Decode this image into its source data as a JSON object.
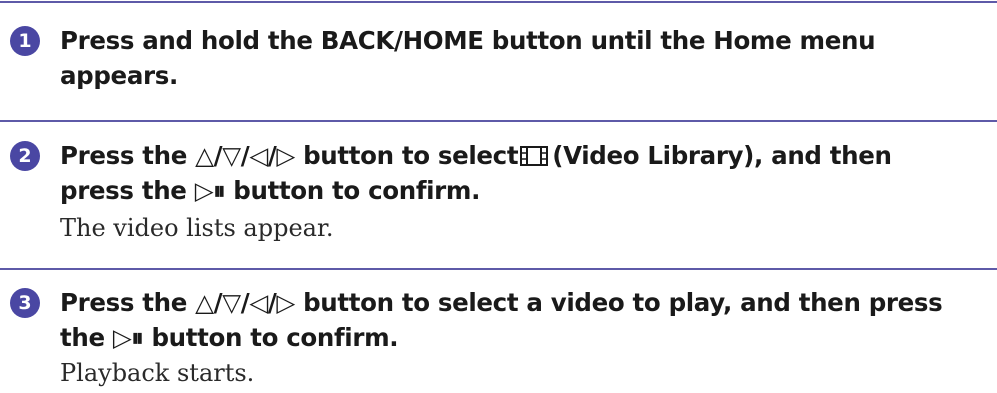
{
  "steps": [
    {
      "number": "1",
      "instruction": "Press and hold the BACK/HOME button until the Home menu",
      "instruction_cont": "appears."
    },
    {
      "number": "2",
      "instruction_a": "Press the △/▽/◁/▷ button to select",
      "icon": "video-library-icon",
      "instruction_b": "(Video Library), and then",
      "instruction_cont": "press the ▷⏸ button to confirm.",
      "result": "The video lists appear."
    },
    {
      "number": "3",
      "instruction": "Press the △/▽/◁/▷ button to select a video to play, and then press",
      "instruction_cont": "the ▷⏸ button to confirm.",
      "result": "Playback starts."
    }
  ],
  "colors": {
    "accent": "#4a47a3",
    "divider": "#5e5aa8",
    "text": "#1a1a1a"
  }
}
